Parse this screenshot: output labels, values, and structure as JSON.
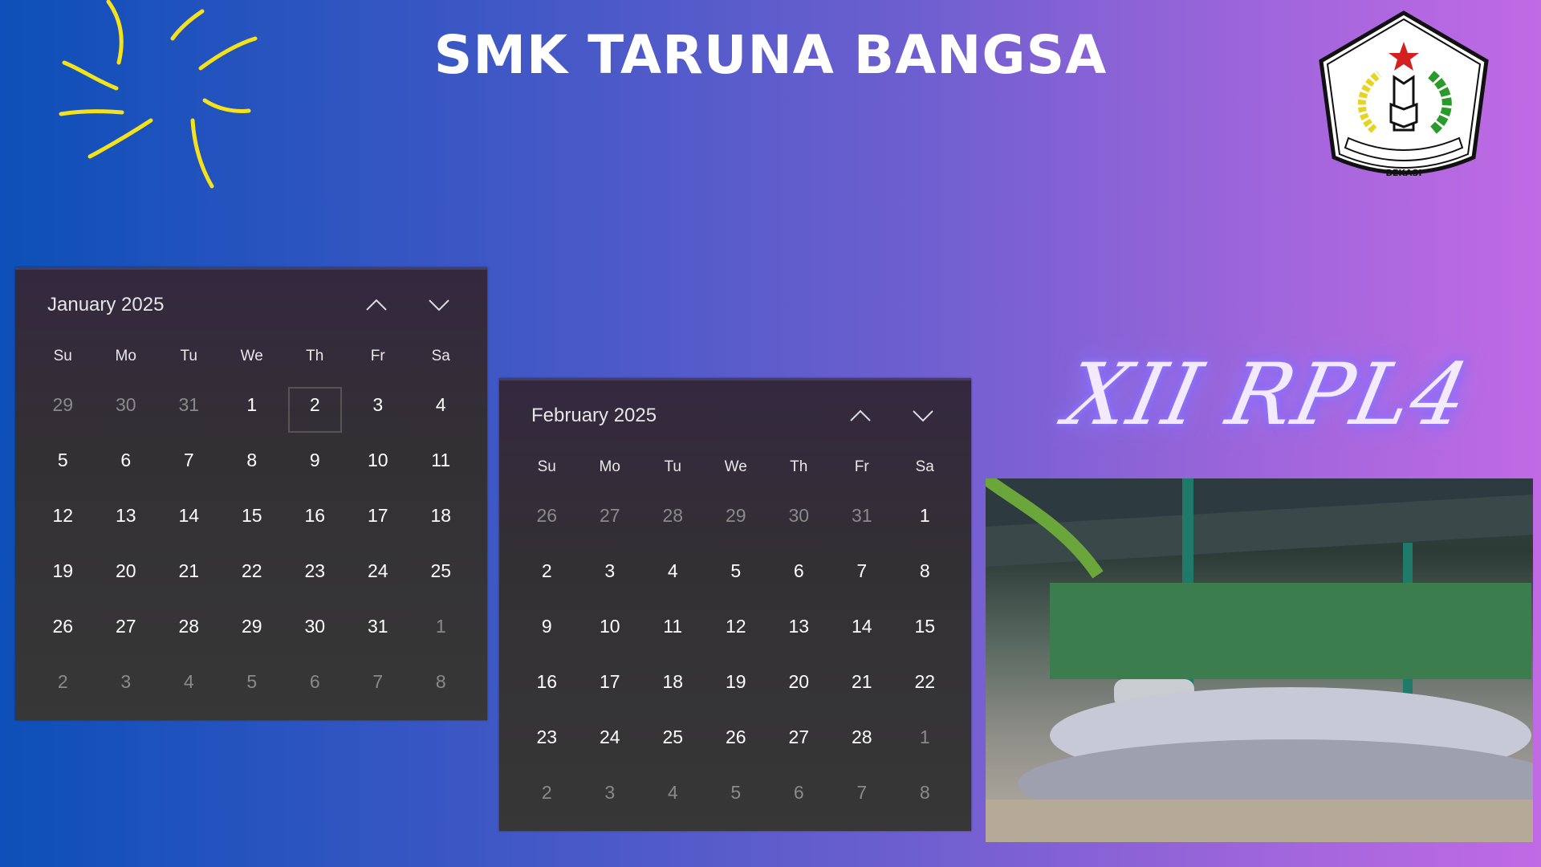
{
  "header": {
    "title": "SMK TARUNA BANGSA"
  },
  "class_label": "XII RPL4",
  "logo": {
    "text": "YAYASAN PENDIDIKAN NASIONAL TARUNA BANGSA",
    "city": "BEKASI"
  },
  "colors": {
    "sparkle": "#f5e21b",
    "calendar_bg": "#363336",
    "bg_left": "#0d4fb8",
    "bg_right": "#c06ae4"
  },
  "weekdays": [
    "Su",
    "Mo",
    "Tu",
    "We",
    "Th",
    "Fr",
    "Sa"
  ],
  "calendars": [
    {
      "month": "January 2025",
      "prev_icon": "chevron-up",
      "next_icon": "chevron-down",
      "today": "2",
      "days": [
        [
          "29",
          1
        ],
        [
          "30",
          1
        ],
        [
          "31",
          1
        ],
        [
          "1",
          0
        ],
        [
          "2",
          0
        ],
        [
          "3",
          0
        ],
        [
          "4",
          0
        ],
        [
          "5",
          0
        ],
        [
          "6",
          0
        ],
        [
          "7",
          0
        ],
        [
          "8",
          0
        ],
        [
          "9",
          0
        ],
        [
          "10",
          0
        ],
        [
          "11",
          0
        ],
        [
          "12",
          0
        ],
        [
          "13",
          0
        ],
        [
          "14",
          0
        ],
        [
          "15",
          0
        ],
        [
          "16",
          0
        ],
        [
          "17",
          0
        ],
        [
          "18",
          0
        ],
        [
          "19",
          0
        ],
        [
          "20",
          0
        ],
        [
          "21",
          0
        ],
        [
          "22",
          0
        ],
        [
          "23",
          0
        ],
        [
          "24",
          0
        ],
        [
          "25",
          0
        ],
        [
          "26",
          0
        ],
        [
          "27",
          0
        ],
        [
          "28",
          0
        ],
        [
          "29",
          0
        ],
        [
          "30",
          0
        ],
        [
          "31",
          0
        ],
        [
          "1",
          1
        ],
        [
          "2",
          1
        ],
        [
          "3",
          1
        ],
        [
          "4",
          1
        ],
        [
          "5",
          1
        ],
        [
          "6",
          1
        ],
        [
          "7",
          1
        ],
        [
          "8",
          1
        ]
      ]
    },
    {
      "month": "February 2025",
      "prev_icon": "chevron-up",
      "next_icon": "chevron-down",
      "days": [
        [
          "26",
          1
        ],
        [
          "27",
          1
        ],
        [
          "28",
          1
        ],
        [
          "29",
          1
        ],
        [
          "30",
          1
        ],
        [
          "31",
          1
        ],
        [
          "1",
          0
        ],
        [
          "2",
          0
        ],
        [
          "3",
          0
        ],
        [
          "4",
          0
        ],
        [
          "5",
          0
        ],
        [
          "6",
          0
        ],
        [
          "7",
          0
        ],
        [
          "8",
          0
        ],
        [
          "9",
          0
        ],
        [
          "10",
          0
        ],
        [
          "11",
          0
        ],
        [
          "12",
          0
        ],
        [
          "13",
          0
        ],
        [
          "14",
          0
        ],
        [
          "15",
          0
        ],
        [
          "16",
          0
        ],
        [
          "17",
          0
        ],
        [
          "18",
          0
        ],
        [
          "19",
          0
        ],
        [
          "20",
          0
        ],
        [
          "21",
          0
        ],
        [
          "22",
          0
        ],
        [
          "23",
          0
        ],
        [
          "24",
          0
        ],
        [
          "25",
          0
        ],
        [
          "26",
          0
        ],
        [
          "27",
          0
        ],
        [
          "28",
          0
        ],
        [
          "1",
          1
        ],
        [
          "2",
          1
        ],
        [
          "3",
          1
        ],
        [
          "4",
          1
        ],
        [
          "5",
          1
        ],
        [
          "6",
          1
        ],
        [
          "7",
          1
        ],
        [
          "8",
          1
        ]
      ]
    }
  ]
}
